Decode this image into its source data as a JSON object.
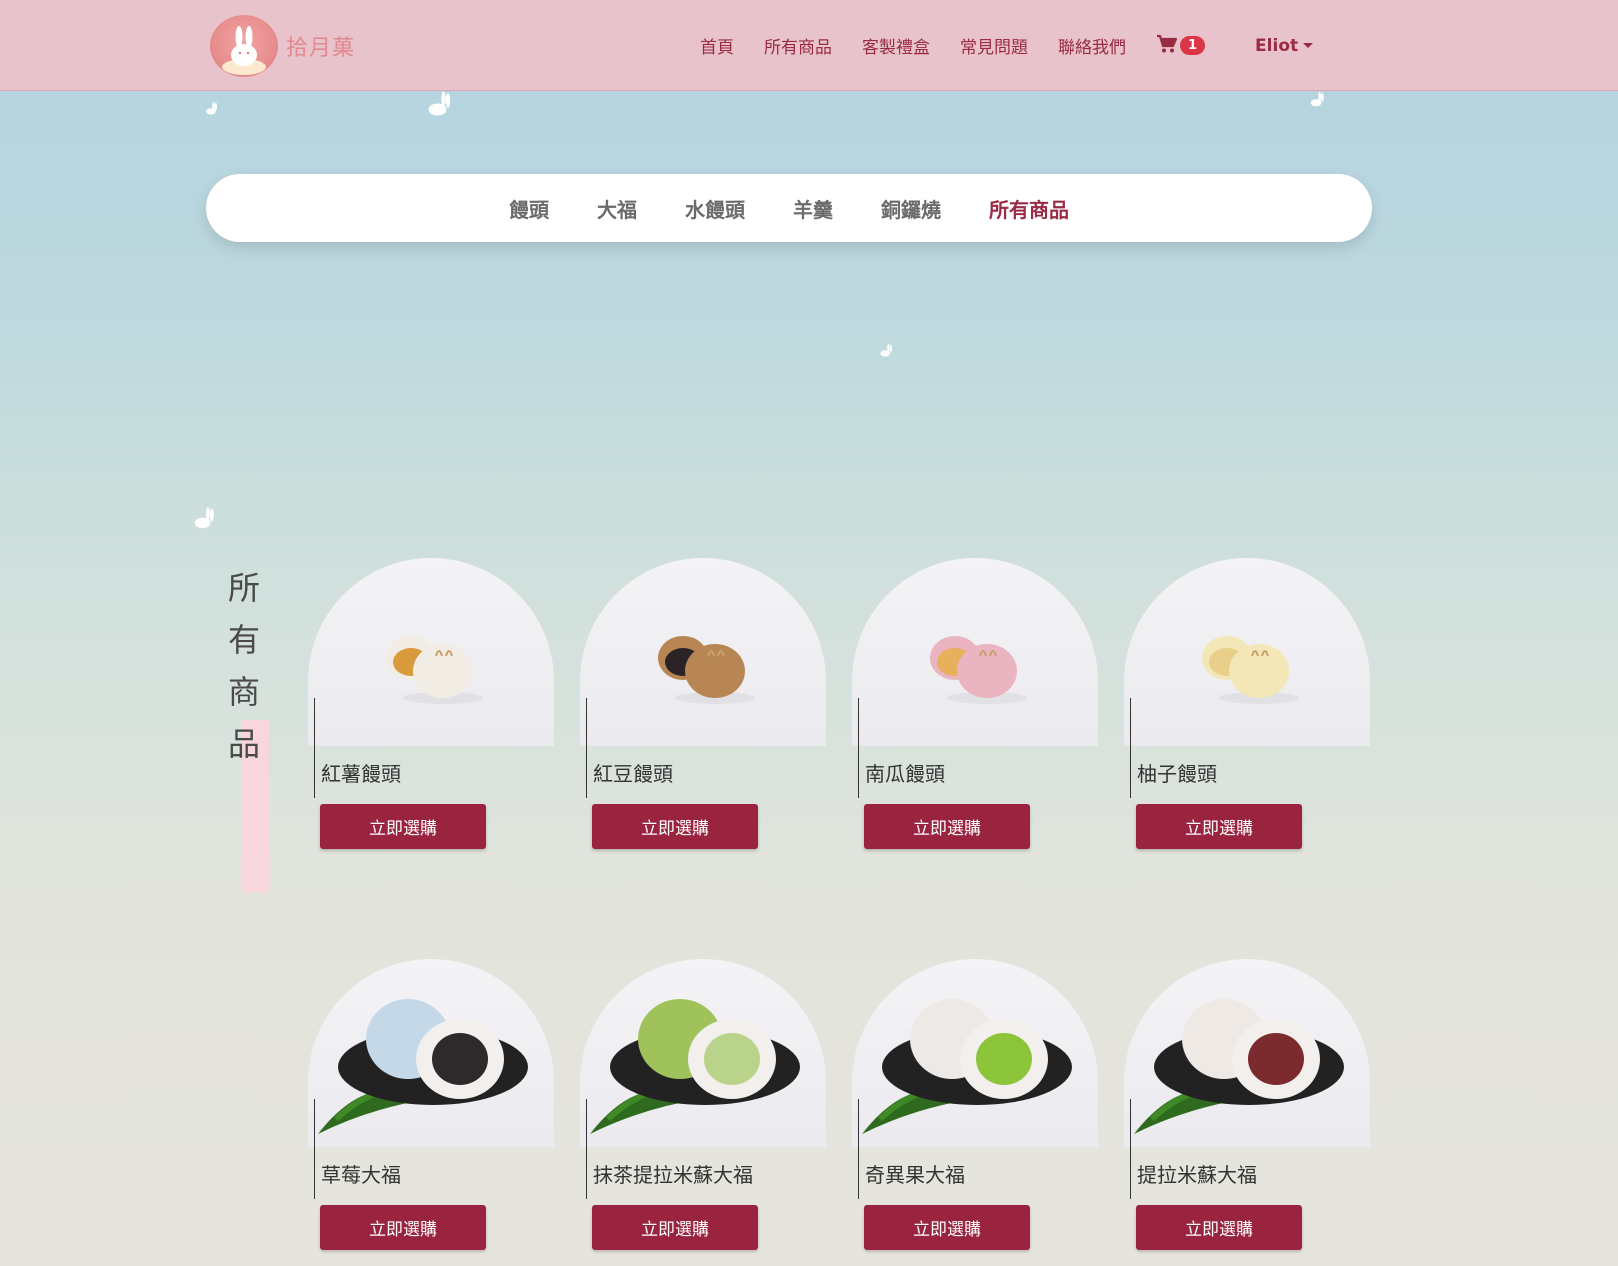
{
  "header": {
    "logo_text": "拾月菓",
    "nav": [
      "首頁",
      "所有商品",
      "客製禮盒",
      "常見問題",
      "聯絡我們"
    ],
    "cart_count": "1",
    "user_name": "Eliot"
  },
  "categories": [
    {
      "label": "饅頭",
      "active": false
    },
    {
      "label": "大福",
      "active": false
    },
    {
      "label": "水饅頭",
      "active": false
    },
    {
      "label": "羊羹",
      "active": false
    },
    {
      "label": "銅鑼燒",
      "active": false
    },
    {
      "label": "所有商品",
      "active": true
    }
  ],
  "section_title": [
    "所",
    "有",
    "商",
    "品"
  ],
  "products": [
    {
      "name": "紅薯饅頭",
      "button": "立即選購",
      "kind": "manju",
      "color": "#f1ece4",
      "filling": "#d99a3c"
    },
    {
      "name": "紅豆饅頭",
      "button": "立即選購",
      "kind": "manju",
      "color": "#b88655",
      "filling": "#2b2326"
    },
    {
      "name": "南瓜饅頭",
      "button": "立即選購",
      "kind": "manju",
      "color": "#eab5c0",
      "filling": "#e7b05a"
    },
    {
      "name": "柚子饅頭",
      "button": "立即選購",
      "kind": "manju",
      "color": "#f3e7b7",
      "filling": "#e8d08a"
    },
    {
      "name": "草莓大福",
      "button": "立即選購",
      "kind": "daifuku",
      "color": "#c5d8e8",
      "filling": "#2e2a2c"
    },
    {
      "name": "抹茶提拉米蘇大福",
      "button": "立即選購",
      "kind": "daifuku",
      "color": "#9fc35a",
      "filling": "#b9d48a"
    },
    {
      "name": "奇異果大福",
      "button": "立即選購",
      "kind": "daifuku",
      "color": "#ece9e6",
      "filling": "#8cc53a"
    },
    {
      "name": "提拉米蘇大福",
      "button": "立即選購",
      "kind": "daifuku",
      "color": "#efe9e6",
      "filling": "#7b2a2e"
    }
  ]
}
